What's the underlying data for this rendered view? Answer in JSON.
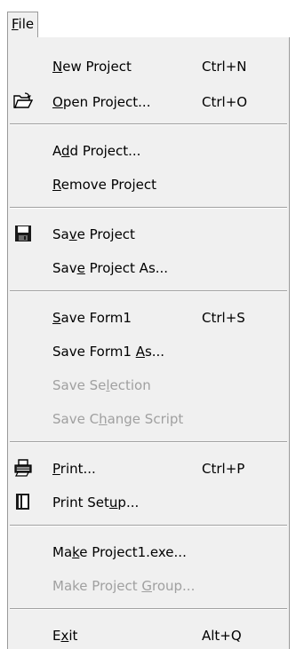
{
  "menubar": {
    "title_prefix": "",
    "title_mnemonic": "F",
    "title_rest": "ile"
  },
  "menu": {
    "new_project": {
      "pre": "",
      "mn": "N",
      "post": "ew Project",
      "shortcut": "Ctrl+N"
    },
    "open_project": {
      "pre": "",
      "mn": "O",
      "post": "pen Project...",
      "shortcut": "Ctrl+O"
    },
    "add_project": {
      "pre": "A",
      "mn": "d",
      "post": "d Project...",
      "shortcut": ""
    },
    "remove_project": {
      "pre": "",
      "mn": "R",
      "post": "emove Project",
      "shortcut": ""
    },
    "save_project": {
      "pre": "Sa",
      "mn": "v",
      "post": "e Project",
      "shortcut": ""
    },
    "save_project_as": {
      "pre": "Sav",
      "mn": "e",
      "post": " Project As...",
      "shortcut": ""
    },
    "save_form": {
      "pre": "",
      "mn": "S",
      "post": "ave Form1",
      "shortcut": "Ctrl+S"
    },
    "save_form_as": {
      "pre": "Save Form1 ",
      "mn": "A",
      "post": "s...",
      "shortcut": ""
    },
    "save_selection": {
      "pre": "Save Se",
      "mn": "l",
      "post": "ection",
      "shortcut": ""
    },
    "save_change_script": {
      "pre": "Save C",
      "mn": "h",
      "post": "ange Script",
      "shortcut": ""
    },
    "print": {
      "pre": "",
      "mn": "P",
      "post": "rint...",
      "shortcut": "Ctrl+P"
    },
    "print_setup": {
      "pre": "Print Set",
      "mn": "u",
      "post": "p...",
      "shortcut": ""
    },
    "make_exe": {
      "pre": "Ma",
      "mn": "k",
      "post": "e Project1.exe...",
      "shortcut": ""
    },
    "make_group": {
      "pre": "Make Project ",
      "mn": "G",
      "post": "roup...",
      "shortcut": ""
    },
    "exit": {
      "pre": "E",
      "mn": "x",
      "post": "it",
      "shortcut": "Alt+Q"
    }
  },
  "icons": {
    "open": "open-folder-icon",
    "save": "floppy-disk-icon",
    "print": "printer-icon",
    "print_setup": "print-setup-icon"
  }
}
